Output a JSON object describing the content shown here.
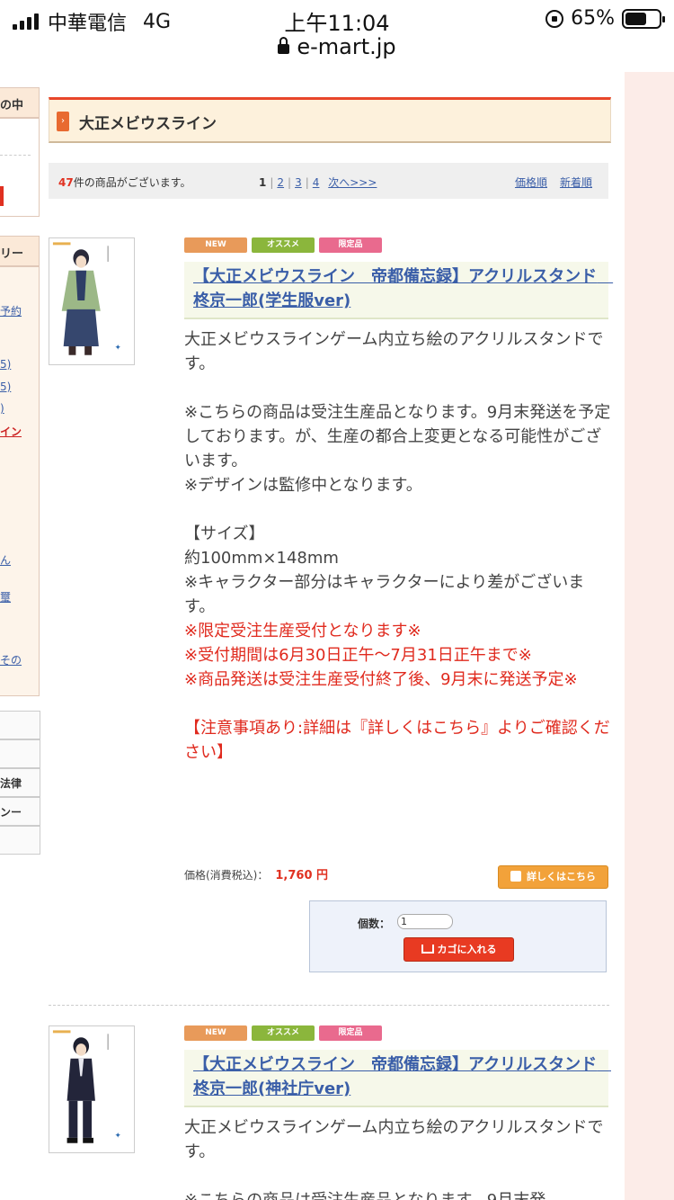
{
  "status_bar": {
    "carrier": "中華電信",
    "network": "4G",
    "time": "上午11:04",
    "battery": "65%",
    "battery_level": 0.65,
    "url": "e-mart.jp"
  },
  "sidebar": {
    "box1_text": "の中",
    "box2_text": "リー",
    "links": [
      "予約",
      "5)",
      "5)",
      ")",
      "イン",
      "ん",
      "璽",
      "その"
    ],
    "menu_items": [
      "",
      "",
      "法律",
      "ンー",
      ""
    ]
  },
  "category": {
    "title": "大正メビウスライン"
  },
  "listing": {
    "count": "47",
    "count_suffix": "件の商品がございます。",
    "current_page": "1",
    "pages": [
      "2",
      "3",
      "4"
    ],
    "next_label": "次へ>>>",
    "sort_price": "価格順",
    "sort_new": "新着順"
  },
  "products": [
    {
      "tags": [
        "NEW",
        "オススメ",
        "限定品"
      ],
      "title": "【大正メビウスライン　帝都備忘録】アクリルスタンド　柊京一郎(学生服ver)",
      "description": "大正メビウスラインゲーム内立ち絵のアクリルスタンドです。\n\n※こちらの商品は受注生産品となります。9月末発送を予定しております。が、生産の都合上変更となる可能性がございます。\n※デザインは監修中となります。\n\n【サイズ】\n約100mm×148mm\n※キャラクター部分はキャラクターにより差がございます。",
      "notice": "※限定受注生産受付となります※\n※受付期間は6月30日正午〜7月31日正午まで※\n※商品発送は受注生産受付終了後、9月末に発送予定※\n\n【注意事項あり:詳細は『詳しくはこちら』よりご確認ください】",
      "price_label": "価格(消費税込)：",
      "price": "1,760 円",
      "detail_button": "詳しくはこちら",
      "qty_label": "個数：",
      "qty_value": "1",
      "cart_button": "カゴに入れる"
    },
    {
      "tags": [
        "NEW",
        "オススメ",
        "限定品"
      ],
      "title": "【大正メビウスライン　帝都備忘録】アクリルスタンド　柊京一郎(神社庁ver)",
      "description": "大正メビウスラインゲーム内立ち絵のアクリルスタンドです。\n\n※こちらの商品は受注生産品となります。9月末発"
    }
  ]
}
